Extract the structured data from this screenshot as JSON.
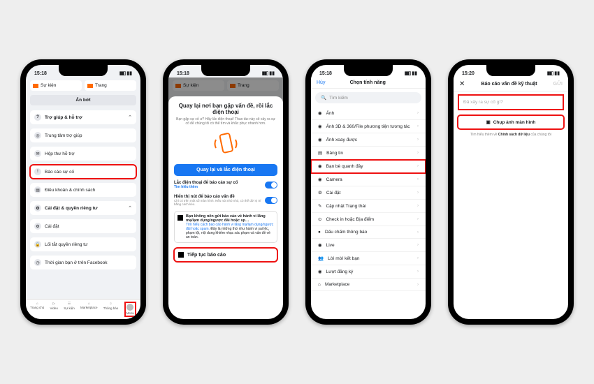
{
  "common": {
    "tab_events": "Sự kiện",
    "tab_pages": "Trang",
    "collapse": "Ẩn bớt"
  },
  "p1": {
    "time": "15:18",
    "sec_help": "Trợ giúp & hỗ trợ",
    "help_center": "Trung tâm trợ giúp",
    "support_inbox": "Hộp thư hỗ trợ",
    "report": "Báo cáo sự cố",
    "terms": "Điều khoản & chính sách",
    "sec_settings": "Cài đặt & quyền riêng tư",
    "settings": "Cài đặt",
    "privacy_shortcuts": "Lối tắt quyền riêng tư",
    "time_on_fb": "Thời gian bạn ở trên Facebook",
    "nav": [
      "Trang chủ",
      "Video",
      "Sự kiện",
      "Marketplace",
      "Thông báo",
      "Menu"
    ]
  },
  "p2": {
    "time": "15:18",
    "title": "Quay lại nơi bạn gặp vấn đề, rồi lắc điện thoại",
    "sub": "Bạn gặp sự cố ư? Hãy lắc điện thoại! Thao tác này sẽ xảy ra sự cố để chúng tôi có thể tìm và khắc phục nhanh hơn.",
    "btn_blue": "Quay lại và lắc điện thoại",
    "t1": "Lắc điện thoại để báo cáo sự cố",
    "t1_link": "Tìm hiểu thêm",
    "t2": "Hiển thị nút để báo cáo vấn đề",
    "t2_sub": "Chỉ có trên một số màn hình. Nếu nút nhỏ nhỏ, có thể dời vị trí bằng cách kéo.",
    "info_b": "Bạn không nên gửi báo cáo về hành vi lăng mạ/lạm dụng/ngược đãi hoặc sp…",
    "info_link": "Tìm hiểu cách báo cáo hành vi lăng mạ/lạm dụng/ngược đãi hoặc spam.",
    "info_txt": "Đây là những thứ như hành vi sai lệc, phạm tội, nội dung khiếm nhạc xác phạm và vấn đề về an toàn.",
    "continue": "Tiếp tục báo cáo"
  },
  "p3": {
    "time": "15:18",
    "cancel": "Hủy",
    "title": "Chọn tính năng",
    "search": "Tìm kiếm",
    "items": [
      "Ảnh",
      "Ảnh 3D & 360/File phương tiện tương tác",
      "Ảnh xoay được",
      "Bảng tin",
      "Bạn bè quanh đây",
      "Camera",
      "Cài đặt",
      "Cập nhật Trạng thái",
      "Check in hoặc Địa điểm",
      "Dấu chấm thông báo",
      "Live",
      "Lời mời kết bạn",
      "Lượt đăng ký",
      "Marketplace"
    ]
  },
  "p4": {
    "time": "15:20",
    "title": "Báo cáo vấn đề kỹ thuật",
    "send": "GỬI",
    "placeholder": "Đã xảy ra sự cố gì?",
    "screenshot": "Chụp ảnh màn hình",
    "tiny_a": "Tìm hiểu thêm về ",
    "tiny_b": "Chính sách dữ liệu",
    "tiny_c": " của chúng tôi"
  }
}
